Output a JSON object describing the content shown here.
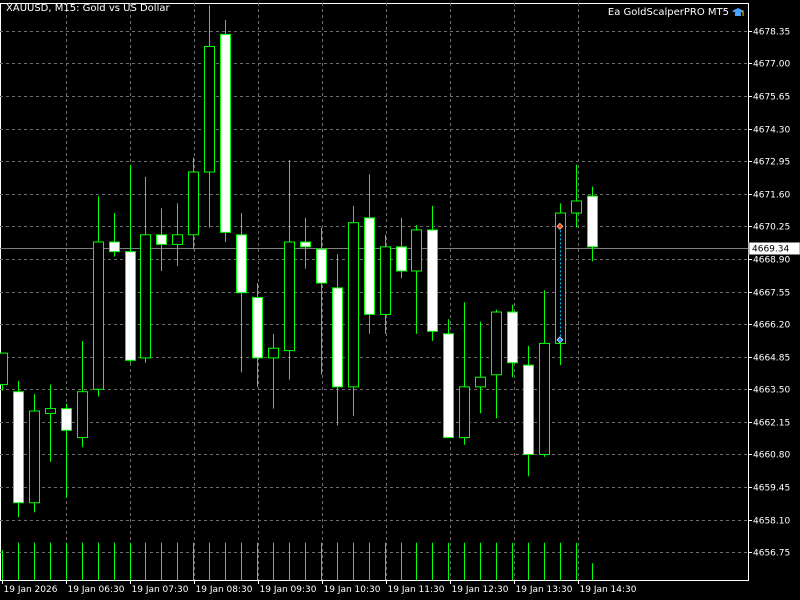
{
  "window": {
    "symbol": "XAUUSD, M15:",
    "symbol_desc": "Gold vs US Dollar",
    "expert_name": "Ea GoldScalperPRO MT5",
    "expert_icon": "graduation-cap-icon"
  },
  "colors": {
    "background": "#000000",
    "bull_body": "#000000",
    "bear_body": "#ffffff",
    "candle_border": "#00ff00",
    "wick": "#00ff00",
    "grid": "#6e6e6e",
    "volume": "#00ff00",
    "price_line": "#7f7f7f",
    "text": "#ffffff",
    "sell_marker": "#ff4500",
    "buy_marker": "#1e90ff"
  },
  "chart_data": {
    "type": "candlestick",
    "symbol": "XAUUSD",
    "timeframe": "M15",
    "current_price": "4669.34",
    "ylim": [
      4655.6,
      4679.5
    ],
    "y_ticks": [
      "4678.35",
      "4677.00",
      "4675.65",
      "4674.30",
      "4672.95",
      "4671.60",
      "4670.25",
      "4668.90",
      "4667.55",
      "4666.20",
      "4664.85",
      "4663.50",
      "4662.15",
      "4660.80",
      "4659.45",
      "4658.10",
      "4656.75"
    ],
    "x_ticks": [
      "19 Jan 2026",
      "19 Jan 06:30",
      "19 Jan 07:30",
      "19 Jan 08:30",
      "19 Jan 09:30",
      "19 Jan 10:30",
      "19 Jan 11:30",
      "19 Jan 12:30",
      "19 Jan 13:30",
      "19 Jan 14:30"
    ],
    "candles": [
      {
        "o": 4663.7,
        "h": 4665.0,
        "l": 4663.45,
        "c": 4665.0
      },
      {
        "o": 4663.4,
        "h": 4663.85,
        "l": 4658.2,
        "c": 4658.8
      },
      {
        "o": 4658.8,
        "h": 4663.3,
        "l": 4658.4,
        "c": 4662.6
      },
      {
        "o": 4662.5,
        "h": 4663.7,
        "l": 4660.5,
        "c": 4662.7
      },
      {
        "o": 4662.7,
        "h": 4662.9,
        "l": 4659.0,
        "c": 4661.8
      },
      {
        "o": 4661.5,
        "h": 4665.5,
        "l": 4661.1,
        "c": 4663.4
      },
      {
        "o": 4663.5,
        "h": 4671.5,
        "l": 4663.2,
        "c": 4669.6
      },
      {
        "o": 4669.6,
        "h": 4670.8,
        "l": 4669.0,
        "c": 4669.2
      },
      {
        "o": 4669.2,
        "h": 4672.8,
        "l": 4664.6,
        "c": 4664.7
      },
      {
        "o": 4664.8,
        "h": 4672.3,
        "l": 4664.6,
        "c": 4669.9
      },
      {
        "o": 4669.9,
        "h": 4671.0,
        "l": 4668.4,
        "c": 4669.5
      },
      {
        "o": 4669.5,
        "h": 4671.2,
        "l": 4668.6,
        "c": 4669.9
      },
      {
        "o": 4669.9,
        "h": 4673.1,
        "l": 4669.3,
        "c": 4672.5
      },
      {
        "o": 4672.5,
        "h": 4679.4,
        "l": 4670.2,
        "c": 4677.7
      },
      {
        "o": 4678.2,
        "h": 4678.8,
        "l": 4669.6,
        "c": 4670.0
      },
      {
        "o": 4669.9,
        "h": 4670.8,
        "l": 4664.2,
        "c": 4667.5
      },
      {
        "o": 4667.3,
        "h": 4667.9,
        "l": 4663.6,
        "c": 4664.8
      },
      {
        "o": 4664.8,
        "h": 4665.8,
        "l": 4662.7,
        "c": 4665.2
      },
      {
        "o": 4665.1,
        "h": 4673.0,
        "l": 4663.9,
        "c": 4669.6
      },
      {
        "o": 4669.6,
        "h": 4670.6,
        "l": 4668.5,
        "c": 4669.4
      },
      {
        "o": 4669.3,
        "h": 4670.2,
        "l": 4664.1,
        "c": 4667.9
      },
      {
        "o": 4667.7,
        "h": 4669.1,
        "l": 4662.0,
        "c": 4663.6
      },
      {
        "o": 4663.6,
        "h": 4671.1,
        "l": 4662.4,
        "c": 4670.4
      },
      {
        "o": 4670.6,
        "h": 4672.4,
        "l": 4665.8,
        "c": 4666.6
      },
      {
        "o": 4666.6,
        "h": 4669.9,
        "l": 4665.8,
        "c": 4669.4
      },
      {
        "o": 4669.4,
        "h": 4670.6,
        "l": 4668.1,
        "c": 4668.4
      },
      {
        "o": 4668.4,
        "h": 4670.3,
        "l": 4665.8,
        "c": 4670.1
      },
      {
        "o": 4670.1,
        "h": 4671.1,
        "l": 4665.5,
        "c": 4665.9
      },
      {
        "o": 4665.8,
        "h": 4666.4,
        "l": 4661.5,
        "c": 4661.5
      },
      {
        "o": 4661.5,
        "h": 4667.1,
        "l": 4661.2,
        "c": 4663.6
      },
      {
        "o": 4663.6,
        "h": 4666.3,
        "l": 4662.5,
        "c": 4664.0
      },
      {
        "o": 4664.1,
        "h": 4666.8,
        "l": 4662.3,
        "c": 4666.7
      },
      {
        "o": 4666.7,
        "h": 4667.0,
        "l": 4664.0,
        "c": 4664.6
      },
      {
        "o": 4664.5,
        "h": 4665.3,
        "l": 4659.9,
        "c": 4660.8
      },
      {
        "o": 4660.8,
        "h": 4667.6,
        "l": 4660.7,
        "c": 4665.4
      },
      {
        "o": 4665.4,
        "h": 4671.2,
        "l": 4664.5,
        "c": 4670.8
      },
      {
        "o": 4670.8,
        "h": 4672.8,
        "l": 4670.2,
        "c": 4671.3
      },
      {
        "o": 4671.5,
        "h": 4671.9,
        "l": 4668.8,
        "c": 4669.4
      }
    ],
    "volumes": [
      0.5,
      0.62,
      0.62,
      0.62,
      0.62,
      0.62,
      0.62,
      0.62,
      0.62,
      0.62,
      0.62,
      0.62,
      0.62,
      0.62,
      0.62,
      0.62,
      0.62,
      0.62,
      0.62,
      0.62,
      0.62,
      0.62,
      0.62,
      0.62,
      0.62,
      0.62,
      0.62,
      0.62,
      0.62,
      0.62,
      0.62,
      0.62,
      0.62,
      0.62,
      0.62,
      0.62,
      0.62,
      0.28
    ],
    "trades": [
      {
        "type": "sell",
        "price": 4670.25,
        "bar": 35
      },
      {
        "type": "buy",
        "price": 4665.55,
        "bar": 35
      }
    ]
  }
}
